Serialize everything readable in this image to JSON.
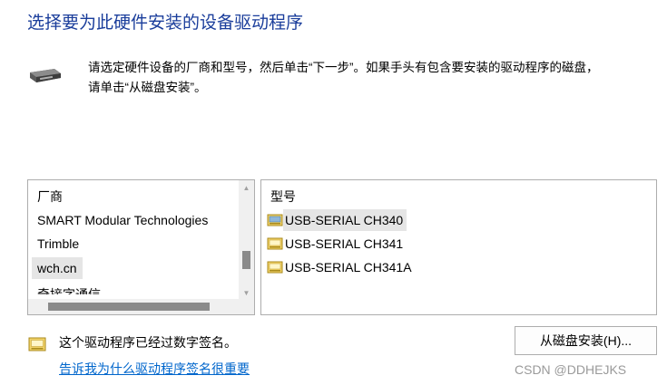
{
  "header": {
    "title": "选择要为此硬件安装的设备驱动程序",
    "description_line1": "请选定硬件设备的厂商和型号，然后单击“下一步”。如果手头有包含要安装的驱动程序的磁盘，",
    "description_line2": "请单击“从磁盘安装”。"
  },
  "manufacturer_list": {
    "header": "厂商",
    "items": [
      {
        "label": "SMART Modular Technologies",
        "selected": false
      },
      {
        "label": "Trimble",
        "selected": false
      },
      {
        "label": "wch.cn",
        "selected": true
      },
      {
        "label": "奇接字通信",
        "selected": false
      }
    ]
  },
  "model_list": {
    "header": "型号",
    "items": [
      {
        "label": "USB-SERIAL CH340",
        "selected": true
      },
      {
        "label": "USB-SERIAL CH341",
        "selected": false
      },
      {
        "label": "USB-SERIAL CH341A",
        "selected": false
      }
    ]
  },
  "signature": {
    "status": "这个驱动程序已经过数字签名。",
    "link": "告诉我为什么驱动程序签名很重要"
  },
  "buttons": {
    "have_disk": "从磁盘安装(H)..."
  },
  "watermark": "CSDN @DDHEJKS",
  "colors": {
    "title": "#1a3d9b",
    "link": "#0066cc",
    "selection": "#e5e5e5"
  }
}
